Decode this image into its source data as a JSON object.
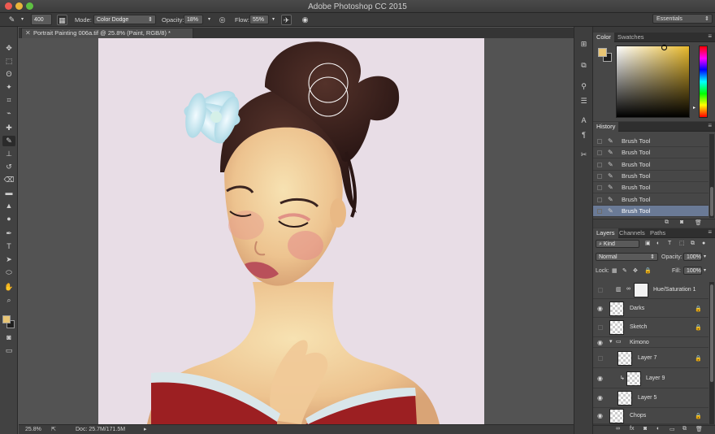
{
  "app": {
    "title": "Adobe Photoshop CC 2015",
    "workspace": "Essentials"
  },
  "options": {
    "brush_size": "400",
    "mode_label": "Mode:",
    "mode_value": "Color Dodge",
    "opacity_label": "Opacity:",
    "opacity_value": "18%",
    "flow_label": "Flow:",
    "flow_value": "55%"
  },
  "document": {
    "tab_title": "Portrait Painting 006a.tif @ 25.8% (Paint, RGB/8) *"
  },
  "status": {
    "zoom": "25.8%",
    "doc_size": "Doc: 25.7M/171.5M"
  },
  "color_panel": {
    "tabs": [
      "Color",
      "Swatches"
    ],
    "foreground": "#e8c575",
    "background": "#1f1f1f"
  },
  "history_panel": {
    "title": "History",
    "items": [
      "Brush Tool",
      "Brush Tool",
      "Brush Tool",
      "Brush Tool",
      "Brush Tool",
      "Brush Tool",
      "Brush Tool"
    ],
    "selected_index": 6
  },
  "layers_panel": {
    "tabs": [
      "Layers",
      "Channels",
      "Paths"
    ],
    "filter_kind": "Kind",
    "blend_mode": "Normal",
    "opacity_label": "Opacity:",
    "opacity_value": "100%",
    "lock_label": "Lock:",
    "fill_label": "Fill:",
    "fill_value": "100%",
    "layers": [
      {
        "name": "Hue/Saturation 1",
        "visible": false,
        "type": "adjustment"
      },
      {
        "name": "Darks",
        "visible": true,
        "type": "layer",
        "locked": true
      },
      {
        "name": "Sketch",
        "visible": false,
        "type": "layer",
        "locked": true
      },
      {
        "name": "Kimono",
        "visible": true,
        "type": "group"
      },
      {
        "name": "Layer 7",
        "visible": false,
        "type": "layer",
        "locked": true
      },
      {
        "name": "Layer 9",
        "visible": true,
        "type": "clipped"
      },
      {
        "name": "Layer 5",
        "visible": true,
        "type": "layer"
      },
      {
        "name": "Chops",
        "visible": true,
        "type": "layer",
        "locked": true
      }
    ]
  }
}
